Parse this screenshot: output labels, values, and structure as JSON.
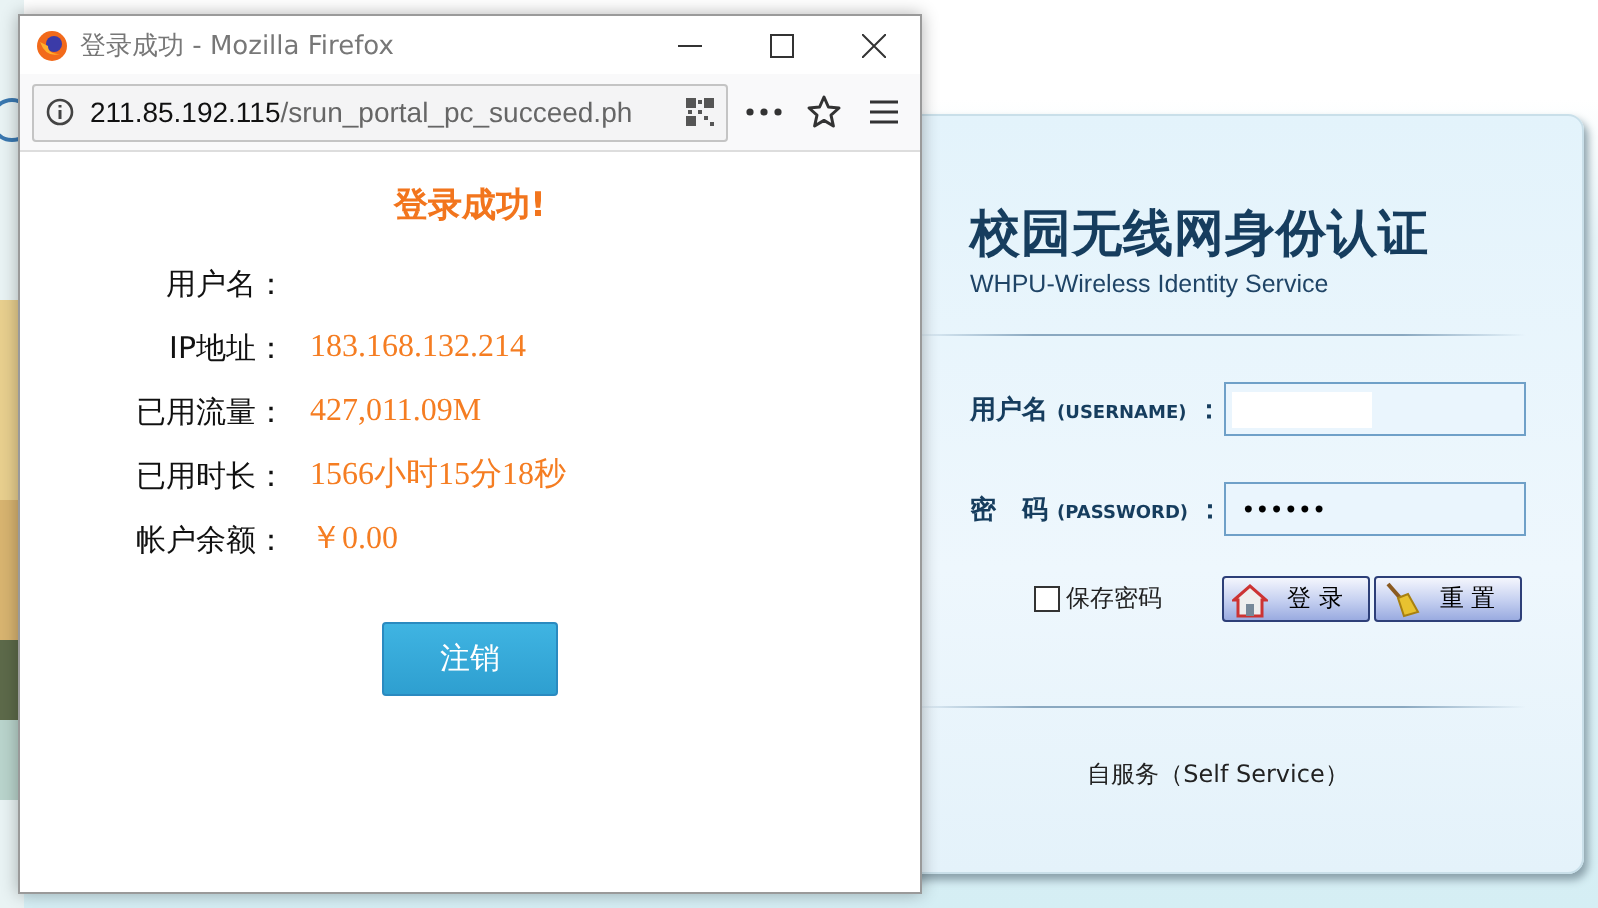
{
  "browser_window": {
    "title": "登录成功 - Mozilla Firefox",
    "url_host": "211.85.192.115",
    "url_path": "/srun_portal_pc_succeed.ph"
  },
  "success_page": {
    "heading": "登录成功!",
    "info": [
      {
        "label": "用户名："
      },
      {
        "label": "IP地址：",
        "value": "183.168.132.214"
      },
      {
        "label": "已用流量：",
        "value": "427,011.09M"
      },
      {
        "label": "已用时长：",
        "value": "1566小时15分18秒"
      },
      {
        "label": "帐户余额：",
        "value": "￥0.00"
      }
    ],
    "logout_button": "注销"
  },
  "login_panel": {
    "title": "校园无线网身份认证",
    "subtitle": "WHPU-Wireless Identity Service",
    "fields": [
      {
        "label": "用户名",
        "hint": "(USERNAME)",
        "colon": "："
      },
      {
        "label": "密　码",
        "hint": "(PASSWORD)",
        "colon": "：",
        "value": "••••••"
      }
    ],
    "remember": {
      "label": "保存密码",
      "checked": false
    },
    "buttons": [
      {
        "kind": "login",
        "label": "登 录"
      },
      {
        "kind": "reset",
        "label": "重 置"
      }
    ],
    "self_service": "自服务（Self Service）"
  }
}
